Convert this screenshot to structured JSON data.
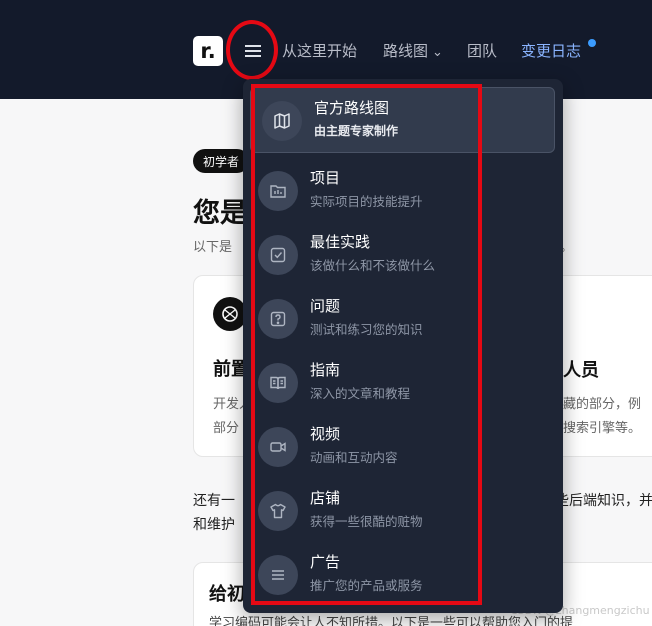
{
  "header": {
    "logo_text": "r.",
    "nav": [
      "从这里开始",
      "路线图",
      "团队",
      "变更日志"
    ],
    "roadmap_chevron": "⌄"
  },
  "background": {
    "tag": "初学者",
    "title": "您是",
    "subtitle_left": "以下是",
    "subtitle_right": "。",
    "card_heading_left": "前置",
    "card_heading_right": "人员",
    "card_p1_left": "开发人",
    "card_p1_right": "隐藏的部分，例",
    "card_p2_left": "部分",
    "card_p2_right": "、搜索引擎等。",
    "para1_left": "还有一",
    "para1_right": "些后端知识，并",
    "para2_left": "和维护",
    "card2_heading": "给初",
    "card2_text": "学习编码可能会让人不知所措。以下是一些可以帮助您入门的提",
    "watermark": "CSDN @zhangmengzichu"
  },
  "dropdown": {
    "items": [
      {
        "title": "官方路线图",
        "desc": "由主题专家制作",
        "icon": "map-icon"
      },
      {
        "title": "项目",
        "desc": "实际项目的技能提升",
        "icon": "folder-chart-icon"
      },
      {
        "title": "最佳实践",
        "desc": "该做什么和不该做什么",
        "icon": "check-square-icon"
      },
      {
        "title": "问题",
        "desc": "测试和练习您的知识",
        "icon": "question-icon"
      },
      {
        "title": "指南",
        "desc": "深入的文章和教程",
        "icon": "book-icon"
      },
      {
        "title": "视频",
        "desc": "动画和互动内容",
        "icon": "video-icon"
      },
      {
        "title": "店铺",
        "desc": "获得一些很酷的赃物",
        "icon": "shirt-icon"
      },
      {
        "title": "广告",
        "desc": "推广您的产品或服务",
        "icon": "menu-lines-icon"
      }
    ]
  },
  "colors": {
    "header_bg": "#131a2b",
    "dropdown_bg": "#1e2535",
    "accent_blue": "#8ab4ff",
    "annotation_red": "#e50914"
  }
}
